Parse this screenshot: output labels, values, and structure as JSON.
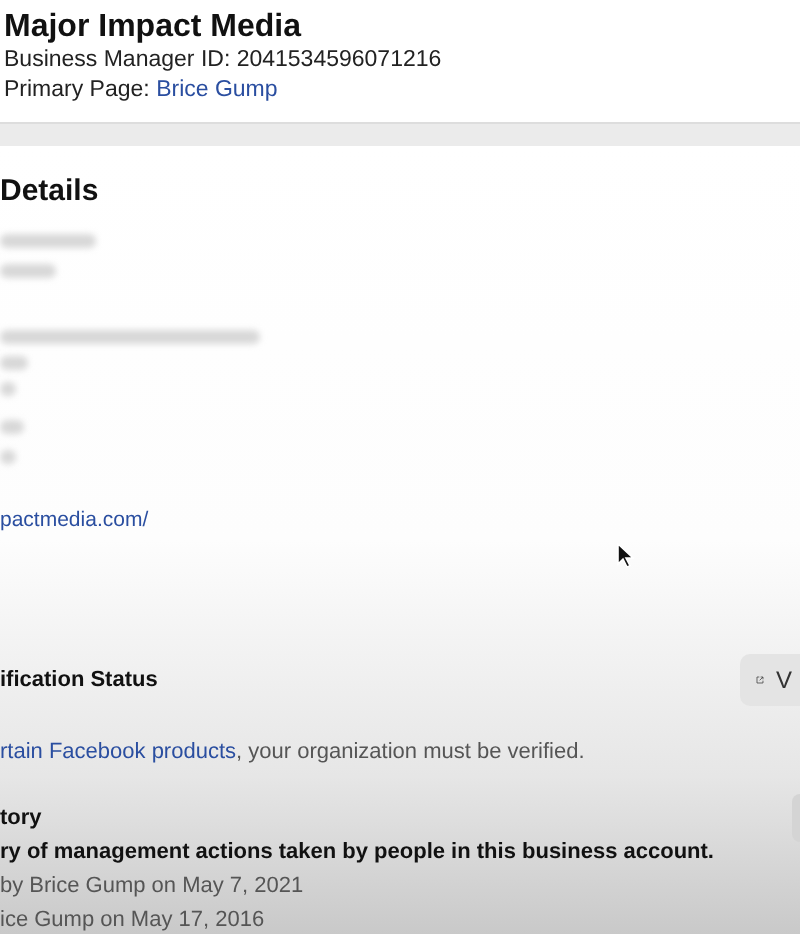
{
  "header": {
    "title": "Major Impact Media",
    "id_line": "Business Manager ID: 2041534596071216",
    "primary_label": "Primary Page: ",
    "primary_link": "Brice Gump"
  },
  "details": {
    "heading": "Details",
    "website_link": "pactmedia.com/"
  },
  "verification": {
    "heading": "ification Status",
    "link": "rtain Facebook products",
    "rest": ", your organization must be verified.",
    "button_label": "V"
  },
  "history": {
    "heading": "tory",
    "summary": "ry of management actions taken by people in this business account.",
    "entries": [
      "by Brice Gump on May 7, 2021",
      "ice Gump on May 17, 2016"
    ]
  }
}
